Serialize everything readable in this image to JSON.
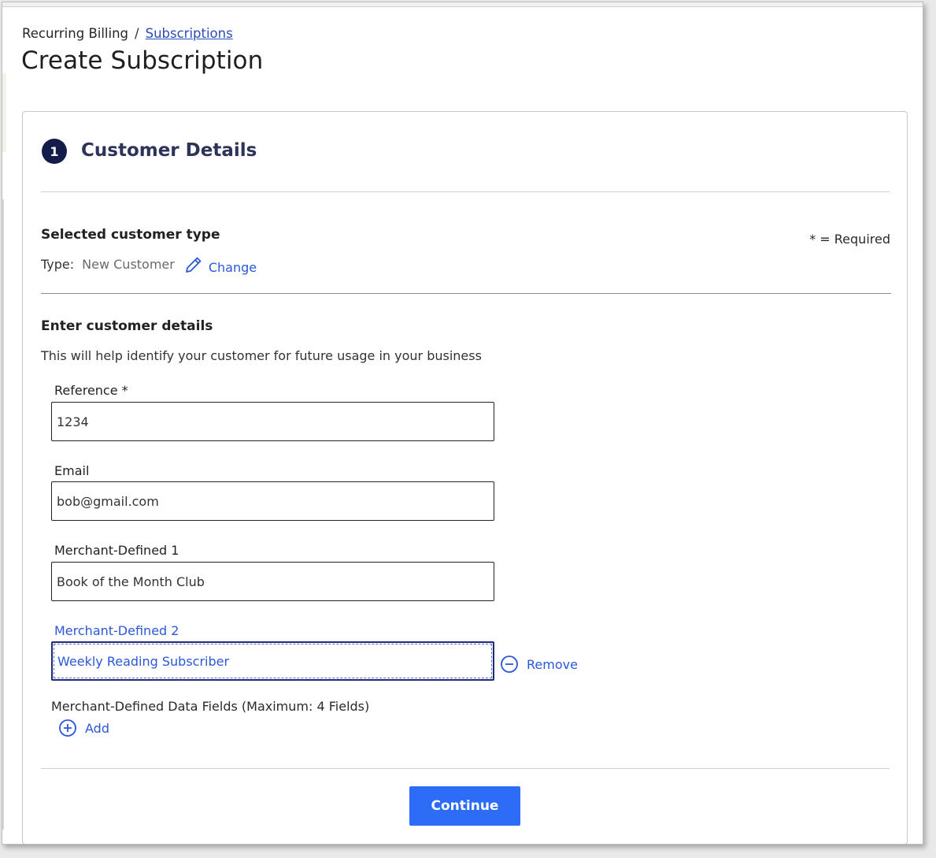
{
  "breadcrumb": {
    "root": "Recurring Billing",
    "separator": "/",
    "link": "Subscriptions"
  },
  "page_title": "Create Subscription",
  "step": {
    "number": "1",
    "title": "Customer Details"
  },
  "customer_type": {
    "heading": "Selected customer type",
    "required_note": "* = Required",
    "type_label": "Type:",
    "type_value": "New Customer",
    "change_label": "Change",
    "change_icon": "pencil-icon"
  },
  "details": {
    "heading": "Enter customer details",
    "helper": "This will help identify your customer for future usage in your business"
  },
  "fields": {
    "reference": {
      "label": "Reference *",
      "value": "1234"
    },
    "email": {
      "label": "Email",
      "value": "bob@gmail.com"
    },
    "merchant_defined_1": {
      "label": "Merchant-Defined 1",
      "value": "Book of the Month Club"
    },
    "merchant_defined_2": {
      "label": "Merchant-Defined 2",
      "value": "Weekly Reading Subscriber"
    }
  },
  "remove": {
    "label": "Remove",
    "icon": "minus-circle-icon"
  },
  "merchant_defined_note": "Merchant-Defined Data Fields (Maximum: 4 Fields)",
  "add": {
    "label": "Add",
    "icon": "plus-circle-icon"
  },
  "continue_label": "Continue",
  "colors": {
    "accent": "#2b57d9",
    "primary_button": "#2c6cf6",
    "step_badge": "#141c4a",
    "title": "#2d3359"
  }
}
